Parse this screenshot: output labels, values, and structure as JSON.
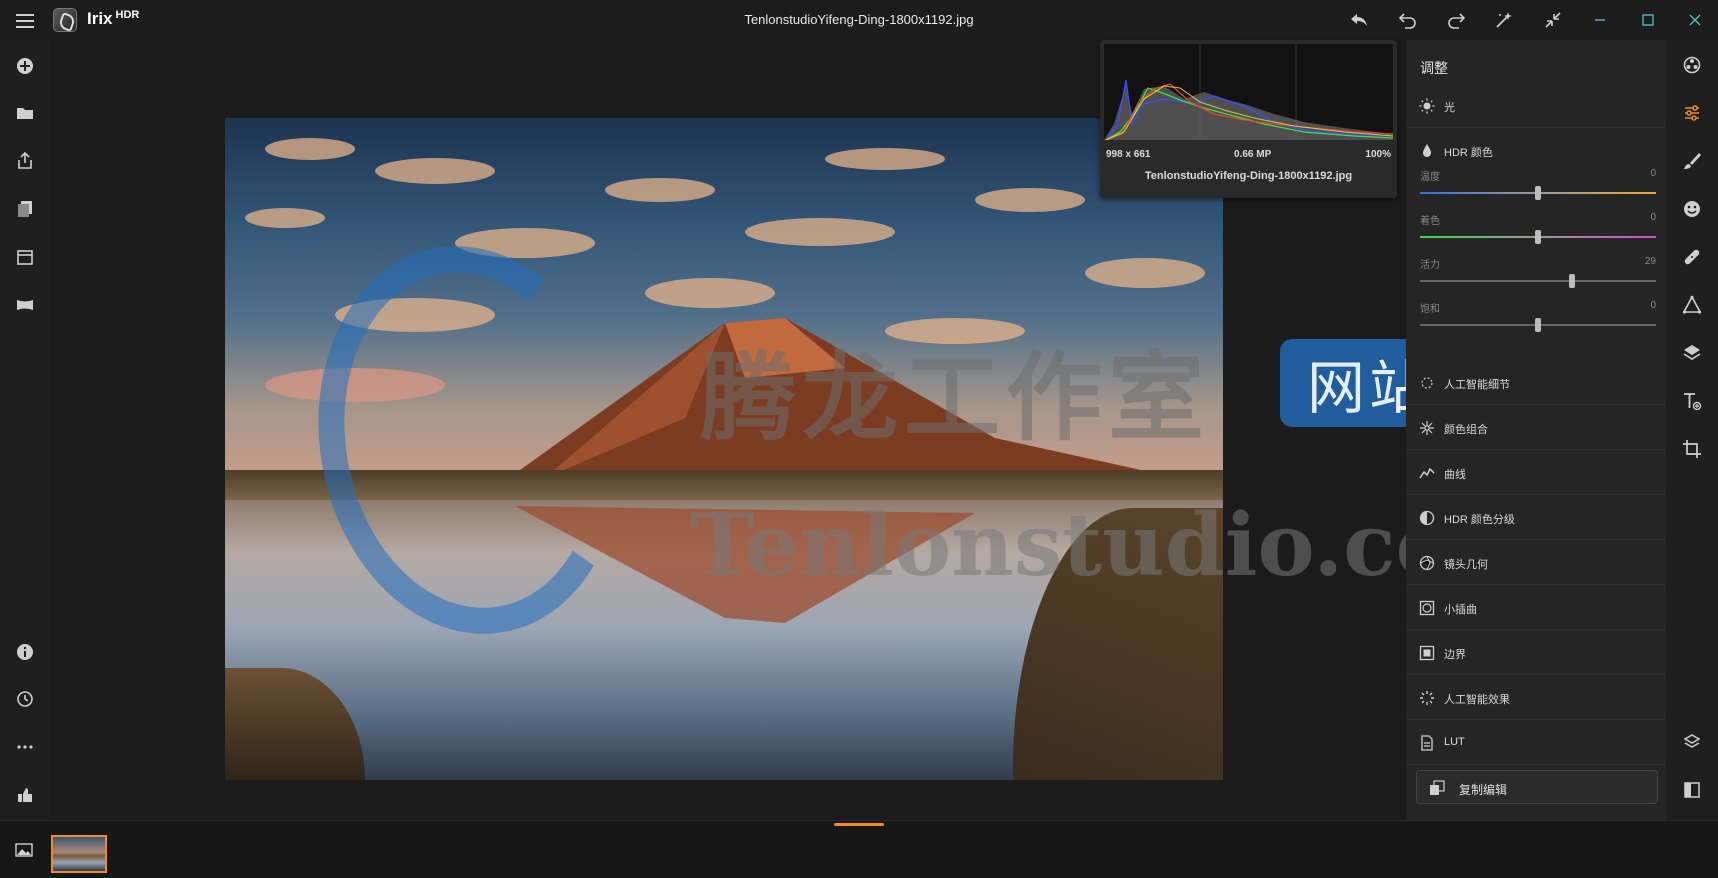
{
  "app": {
    "name": "Irix",
    "name_sup": "HDR",
    "file_title": "TenlonstudioYifeng-Ding-1800x1192.jpg"
  },
  "histogram": {
    "dimensions": "998 x 661",
    "megapixels": "0.66 MP",
    "zoom": "100%",
    "filename": "TenlonstudioYifeng-Ding-1800x1192.jpg"
  },
  "panel": {
    "title": "调整",
    "sections": {
      "light": "光",
      "hdr_color": "HDR 颜色",
      "ai_detail": "人工智能细节",
      "color_combo": "颜色组合",
      "curves": "曲线",
      "hdr_color_grading": "HDR 颜色分级",
      "lens_geometry": "镜头几何",
      "vignette": "小插曲",
      "border": "边界",
      "ai_effects": "人工智能效果",
      "lut": "LUT"
    },
    "sliders": {
      "temperature": {
        "label": "温度",
        "value": "0"
      },
      "tint": {
        "label": "着色",
        "value": "0"
      },
      "vibrance": {
        "label": "活力",
        "value": "29"
      },
      "saturation": {
        "label": "饱和",
        "value": "0"
      }
    },
    "copy_edit": "复制编辑"
  },
  "watermark": {
    "chinese": "腾龙工作室",
    "badge": "网站",
    "english": "Tenlonstudio.com"
  },
  "colors": {
    "accent": "#f28c1a",
    "panel_bg": "#252525",
    "bg": "#1b1b1b"
  }
}
